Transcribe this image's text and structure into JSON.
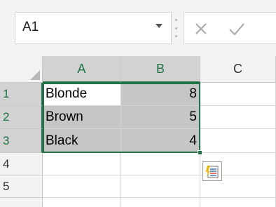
{
  "formula_bar": {
    "name_box": "A1",
    "formula_value": ""
  },
  "columns": [
    {
      "label": "A",
      "selected": true
    },
    {
      "label": "B",
      "selected": true
    },
    {
      "label": "C",
      "selected": false
    }
  ],
  "rows": [
    {
      "label": "1",
      "cells": [
        "Blonde",
        "8",
        ""
      ]
    },
    {
      "label": "2",
      "cells": [
        "Brown",
        "5",
        ""
      ]
    },
    {
      "label": "3",
      "cells": [
        "Black",
        "4",
        ""
      ]
    },
    {
      "label": "4",
      "cells": [
        "",
        "",
        ""
      ]
    },
    {
      "label": "5",
      "cells": [
        "",
        "",
        ""
      ]
    }
  ],
  "selection": {
    "active_cell": "A1",
    "range": "A1:B3"
  },
  "colors": {
    "accent": "#217346",
    "selected_fill": "#c6c6c6",
    "header_bg": "#f3f3f3"
  },
  "icons": {
    "cancel": "close-icon",
    "enter": "checkmark-icon",
    "quick_analysis": "quick-analysis-icon",
    "name_box_dropdown": "chevron-down-icon"
  }
}
